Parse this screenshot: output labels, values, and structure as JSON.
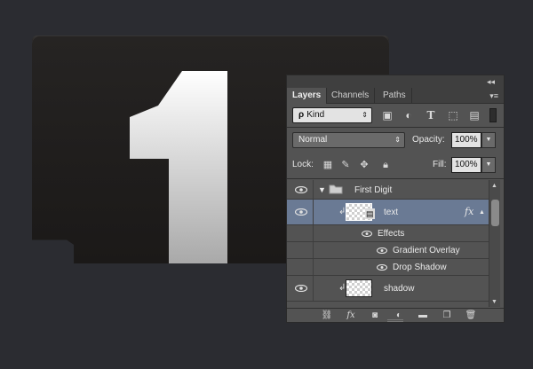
{
  "panel": {
    "tabs": [
      "Layers",
      "Channels",
      "Paths"
    ],
    "filter": {
      "mag": "ρ",
      "label": "Kind"
    },
    "blend_mode": "Normal",
    "opacity_label": "Opacity:",
    "opacity_value": "100%",
    "lock_label": "Lock:",
    "fill_label": "Fill:",
    "fill_value": "100%",
    "layers": {
      "group": "First Digit",
      "text_layer": "text",
      "effects": "Effects",
      "effect_1": "Gradient Overlay",
      "effect_2": "Drop Shadow",
      "shadow_layer": "shadow"
    },
    "fx_symbol": "fx"
  },
  "canvas": {
    "digit": "1"
  },
  "colors": {
    "background": "#2b2c31",
    "panel": "#535353",
    "selection": "#6a7a94"
  }
}
